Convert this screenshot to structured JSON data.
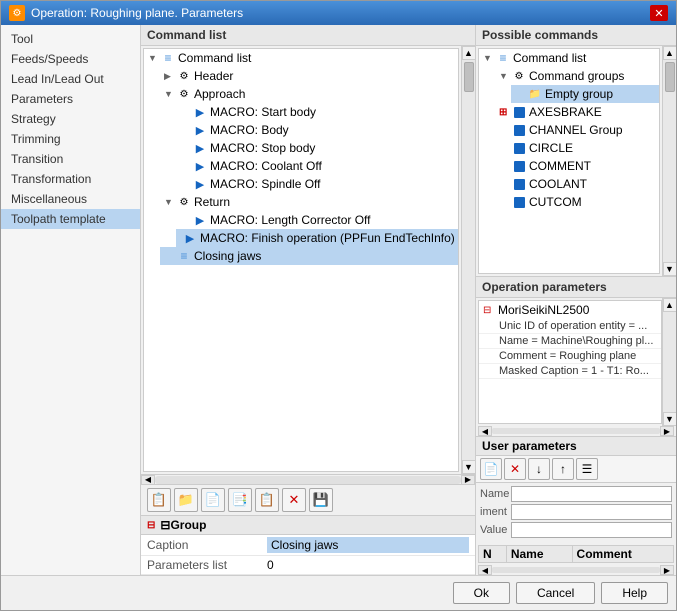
{
  "window": {
    "title": "Operation: Roughing plane. Parameters",
    "close_label": "✕"
  },
  "left_panel": {
    "items": [
      {
        "label": "Tool",
        "selected": false
      },
      {
        "label": "Feeds/Speeds",
        "selected": false
      },
      {
        "label": "Lead In/Lead Out",
        "selected": false
      },
      {
        "label": "Parameters",
        "selected": false
      },
      {
        "label": "Strategy",
        "selected": false
      },
      {
        "label": "Trimming",
        "selected": false
      },
      {
        "label": "Transition",
        "selected": false
      },
      {
        "label": "Transformation",
        "selected": false
      },
      {
        "label": "Miscellaneous",
        "selected": false
      },
      {
        "label": "Toolpath template",
        "selected": true
      }
    ]
  },
  "center_panel": {
    "header": "Command list",
    "tree": [
      {
        "label": "Command list",
        "level": 0,
        "expanded": true,
        "icon": "list"
      },
      {
        "label": "Header",
        "level": 1,
        "expanded": false,
        "icon": "gear"
      },
      {
        "label": "Approach",
        "level": 1,
        "expanded": true,
        "icon": "gear"
      },
      {
        "label": "MACRO: Start body",
        "level": 2,
        "icon": "macro"
      },
      {
        "label": "MACRO: Body",
        "level": 2,
        "icon": "macro"
      },
      {
        "label": "MACRO: Stop body",
        "level": 2,
        "icon": "macro"
      },
      {
        "label": "MACRO: Coolant Off",
        "level": 2,
        "icon": "macro"
      },
      {
        "label": "MACRO: Spindle Off",
        "level": 2,
        "icon": "macro"
      },
      {
        "label": "Return",
        "level": 1,
        "expanded": true,
        "icon": "gear"
      },
      {
        "label": "MACRO: Length Corrector Off",
        "level": 2,
        "icon": "macro"
      },
      {
        "label": "MACRO: Finish operation (PPFun EndTechInfo)",
        "level": 2,
        "icon": "macro",
        "selected": true
      },
      {
        "label": "Closing jaws",
        "level": 1,
        "icon": "list",
        "selected": false,
        "highlighted": true
      }
    ]
  },
  "toolbar_buttons": [
    {
      "icon": "📋",
      "name": "copy-button"
    },
    {
      "icon": "📁",
      "name": "folder-button"
    },
    {
      "icon": "📄",
      "name": "new-button"
    },
    {
      "icon": "📑",
      "name": "duplicate-button"
    },
    {
      "icon": "📋",
      "name": "paste-button"
    },
    {
      "icon": "✕",
      "name": "delete-button",
      "red": true
    },
    {
      "icon": "💾",
      "name": "save-button"
    }
  ],
  "properties": {
    "group_header": "⊟Group",
    "rows": [
      {
        "label": "Caption",
        "value": "Closing jaws",
        "highlighted": true
      },
      {
        "label": "Parameters list",
        "value": "0"
      }
    ]
  },
  "right_panel": {
    "possible_header": "Possible commands",
    "possible_tree": [
      {
        "label": "Command list",
        "level": 0,
        "icon": "list"
      },
      {
        "label": "Command groups",
        "level": 1,
        "icon": "gear",
        "expanded": true
      },
      {
        "label": "Empty group",
        "level": 2,
        "icon": "folder",
        "selected": true
      },
      {
        "label": "AXESBRAKE",
        "level": 1,
        "icon": "block",
        "expand_red": true
      },
      {
        "label": "CHANNEL Group",
        "level": 1,
        "icon": "block"
      },
      {
        "label": "CIRCLE",
        "level": 1,
        "icon": "block"
      },
      {
        "label": "COMMENT",
        "level": 1,
        "icon": "block"
      },
      {
        "label": "COOLANT",
        "level": 1,
        "icon": "block"
      },
      {
        "label": "CUTCOM",
        "level": 1,
        "icon": "block"
      }
    ],
    "op_params_header": "Operation parameters",
    "op_params": [
      {
        "label": "MoriSeikiNL2500",
        "level": 0,
        "expand": "⊟"
      },
      {
        "label": "Unic ID of operation entity = ...",
        "level": 1
      },
      {
        "label": "Name = Machine\\Roughing pl...",
        "level": 1
      },
      {
        "label": "Comment = Roughing plane",
        "level": 1
      },
      {
        "label": "Masked Caption = 1 - T1: Ro...",
        "level": 1
      }
    ],
    "user_params_header": "User parameters",
    "user_toolbar": [
      {
        "icon": "📄",
        "name": "user-new-btn"
      },
      {
        "icon": "✕",
        "name": "user-delete-btn",
        "red": true
      },
      {
        "icon": "↓",
        "name": "user-down-btn"
      },
      {
        "icon": "↑",
        "name": "user-up-btn"
      },
      {
        "icon": "☰",
        "name": "user-list-btn"
      }
    ],
    "user_fields": {
      "name_label": "Name",
      "comment_label": "iment",
      "value_label": "Value",
      "name_value": "",
      "comment_value": "",
      "value_value": ""
    },
    "user_table_headers": [
      "N",
      "Name",
      "Comment"
    ]
  },
  "bottom_buttons": {
    "ok": "Ok",
    "cancel": "Cancel",
    "help": "Help"
  }
}
